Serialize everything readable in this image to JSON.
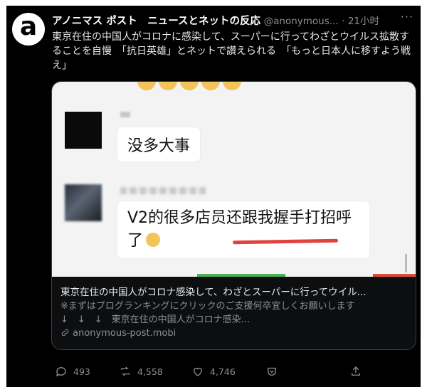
{
  "tweet": {
    "avatar_letter": "a",
    "author_name": "アノニマス ポスト　ニュースとネットの反応",
    "handle": "@anonymous...",
    "time": "· 21小时",
    "more": "···",
    "text": "東京在住の中国人がコロナに感染して、スーパーに行ってわざとウイルス拡散することを自慢　「抗日英雄」とネットで讃えられる　「もっと日本人に移すよう戦え」"
  },
  "card": {
    "bubble_1": "没多大事",
    "bubble_2": "V2的很多店员还跟我握手打招呼了",
    "title": "東京在住の中国人がコロナ感染して、わざとスーパーに行ってウイル...",
    "desc_line1": "※まずはブログランキングにクリックのご支援何卒宜しくお願いします",
    "desc_line2": "↓　↓　↓　東京在住の中国人がコロナ感染...",
    "link": "anonymous-post.mobi"
  },
  "actions": {
    "replies": "493",
    "retweets": "4,558",
    "likes": "4,746"
  },
  "colors": {
    "background": "#000000",
    "muted": "#8b8f95",
    "underline": "#e0433e"
  }
}
